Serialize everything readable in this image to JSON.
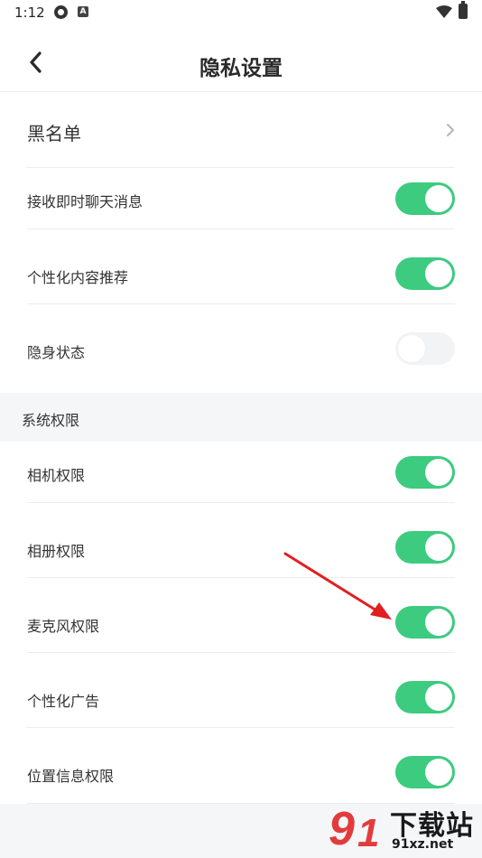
{
  "status_bar": {
    "time": "1:12",
    "badge": "A"
  },
  "header": {
    "title": "隐私设置"
  },
  "blacklist": {
    "label": "黑名单"
  },
  "settings": [
    {
      "label": "接收即时聊天消息",
      "on": true
    },
    {
      "label": "个性化内容推荐",
      "on": true
    },
    {
      "label": "隐身状态",
      "on": false
    }
  ],
  "system_section": {
    "title": "系统权限"
  },
  "permissions": [
    {
      "label": "相机权限",
      "on": true
    },
    {
      "label": "相册权限",
      "on": true
    },
    {
      "label": "麦克风权限",
      "on": true
    },
    {
      "label": "个性化广告",
      "on": true
    },
    {
      "label": "位置信息权限",
      "on": true
    }
  ],
  "watermark": {
    "title": "下载站",
    "url": "91xz.net"
  },
  "colors": {
    "toggle_on": "#3ccb7f",
    "toggle_off": "#f2f3f5",
    "arrow": "#e02020"
  }
}
